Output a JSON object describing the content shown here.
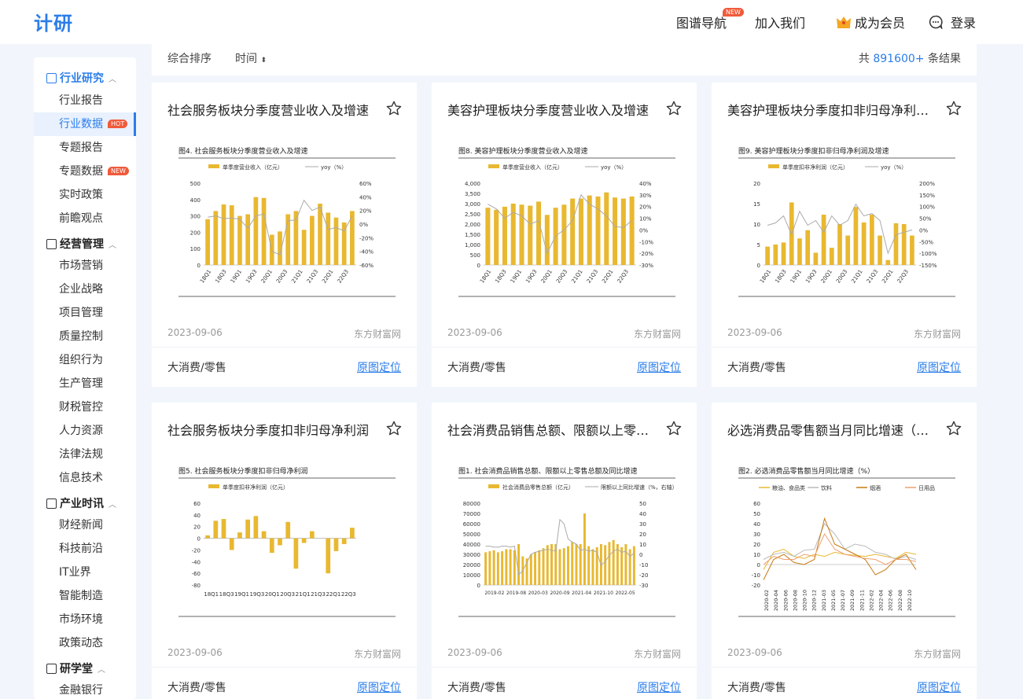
{
  "header": {
    "logo": "计研",
    "nav_guide": "图谱导航",
    "nav_guide_badge": "NEW",
    "nav_join": "加入我们",
    "nav_member": "成为会员",
    "nav_login": "登录"
  },
  "sidebar": {
    "sections": [
      {
        "label": "行业研究",
        "items": [
          "行业报告",
          "行业数据",
          "专题报告",
          "专题数据",
          "实时政策",
          "前瞻观点"
        ]
      },
      {
        "label": "经营管理",
        "items": [
          "市场营销",
          "企业战略",
          "项目管理",
          "质量控制",
          "组织行为",
          "生产管理",
          "财税管控",
          "人力资源",
          "法律法规",
          "信息技术"
        ]
      },
      {
        "label": "产业时讯",
        "items": [
          "财经新闻",
          "科技前沿",
          "IT业界",
          "智能制造",
          "市场环境",
          "政策动态"
        ]
      },
      {
        "label": "研学堂",
        "items": [
          "金融银行"
        ]
      }
    ],
    "tag_hot": "HOT",
    "tag_new": "NEW"
  },
  "sortbar": {
    "sort_default": "综合排序",
    "sort_time": "时间",
    "count_prefix": "共",
    "count_value": "891600+",
    "count_suffix": "条结果"
  },
  "cards": [
    {
      "title": "社会服务板块分季度营业收入及增速",
      "date": "2023-09-06",
      "source": "东方财富网",
      "category": "大消费/零售",
      "link": "原图定位"
    },
    {
      "title": "美容护理板块分季度营业收入及增速",
      "date": "2023-09-06",
      "source": "东方财富网",
      "category": "大消费/零售",
      "link": "原图定位"
    },
    {
      "title": "美容护理板块分季度扣非归母净利润及增速",
      "date": "2023-09-06",
      "source": "东方财富网",
      "category": "大消费/零售",
      "link": "原图定位"
    },
    {
      "title": "社会服务板块分季度扣非归母净利润",
      "date": "2023-09-06",
      "source": "东方财富网",
      "category": "大消费/零售",
      "link": "原图定位"
    },
    {
      "title": "社会消费品销售总额、限额以上零售总额及同比增速",
      "date": "2023-09-06",
      "source": "东方财富网",
      "category": "大消费/零售",
      "link": "原图定位"
    },
    {
      "title": "必选消费品零售额当月同比增速（%）",
      "date": "2023-09-06",
      "source": "东方财富网",
      "category": "大消费/零售",
      "link": "原图定位"
    }
  ],
  "thumbnails": [
    {
      "title": "图4. 社会服务板块分季度营业收入及增速",
      "legend_bar": "单季度营业收入（亿元）",
      "legend_line": "yoy（%）",
      "x": [
        "18Q1",
        "18Q3",
        "19Q1",
        "19Q3",
        "20Q1",
        "20Q3",
        "21Q1",
        "21Q3",
        "22Q1",
        "22Q3"
      ],
      "left_ticks": [
        "500",
        "400",
        "300",
        "200",
        "100",
        "0"
      ],
      "right_ticks": [
        "60%",
        "40%",
        "20%",
        "0%",
        "-20%",
        "-40%",
        "-60%"
      ],
      "left_range": [
        0,
        500
      ],
      "right_range": [
        -60,
        60
      ],
      "bars": [
        280,
        330,
        370,
        365,
        300,
        310,
        415,
        410,
        185,
        205,
        310,
        330,
        215,
        300,
        375,
        320,
        290,
        260,
        330
      ],
      "line": [
        10,
        12,
        8,
        9,
        7,
        -6,
        12,
        15,
        -40,
        -45,
        5,
        6,
        35,
        20,
        25,
        -8,
        -5,
        -10,
        12
      ]
    },
    {
      "title": "图8. 美容护理板块分季度营业收入及增速",
      "legend_bar": "单季度营业收入（亿元）",
      "legend_line": "yoy（%）",
      "x": [
        "18Q1",
        "18Q3",
        "19Q1",
        "19Q3",
        "20Q1",
        "20Q3",
        "21Q1",
        "21Q3",
        "22Q1",
        "22Q3"
      ],
      "left_ticks": [
        "4,000",
        "3,500",
        "3,000",
        "2,500",
        "2,000",
        "1,500",
        "1,000",
        "500",
        "0"
      ],
      "right_ticks": [
        "40%",
        "30%",
        "20%",
        "10%",
        "0%",
        "-10%",
        "-20%",
        "-30%"
      ],
      "left_range": [
        0,
        4000
      ],
      "right_range": [
        -30,
        40
      ],
      "bars": [
        2800,
        2700,
        2850,
        3000,
        2950,
        2900,
        3100,
        2450,
        2800,
        2950,
        3250,
        3250,
        3400,
        3350,
        3550,
        3300,
        3250,
        3350
      ],
      "line": [
        22,
        18,
        10,
        15,
        12,
        5,
        8,
        -20,
        -5,
        0,
        8,
        30,
        22,
        18,
        12,
        3,
        2,
        8
      ]
    },
    {
      "title": "图9. 美容护理板块分季度扣非归母净利润及增速",
      "legend_bar": "单季度扣非净利润（亿元）",
      "legend_line": "yoy（%）",
      "x": [
        "18Q1",
        "18Q3",
        "19Q1",
        "19Q3",
        "20Q1",
        "20Q3",
        "21Q1",
        "21Q3",
        "22Q1",
        "22Q3"
      ],
      "left_ticks": [
        "20",
        "15",
        "10",
        "5",
        "0"
      ],
      "right_ticks": [
        "200%",
        "150%",
        "100%",
        "50%",
        "0%",
        "-50%",
        "-100%",
        "-150%"
      ],
      "left_range": [
        0,
        20
      ],
      "right_range": [
        -150,
        200
      ],
      "bars": [
        4.5,
        5,
        5.5,
        15.3,
        6.5,
        8.5,
        3,
        12.3,
        4.2,
        10,
        7.2,
        14.2,
        10.4,
        12.3,
        7.2,
        1.2,
        10.2,
        10,
        7.2
      ],
      "line": [
        20,
        30,
        60,
        -20,
        80,
        20,
        40,
        -10,
        60,
        20,
        40,
        110,
        60,
        70,
        40,
        -100,
        -20,
        -10,
        0
      ]
    },
    {
      "title": "图5. 社会服务板块分季度扣非归母净利润",
      "legend_bar": "单季度扣非净利润（亿元）",
      "legend_line": "",
      "x": [
        "18Q1",
        "18Q3",
        "19Q1",
        "19Q3",
        "20Q1",
        "20Q3",
        "21Q1",
        "21Q3",
        "22Q1",
        "22Q3"
      ],
      "left_ticks": [
        "60",
        "40",
        "20",
        "0",
        "-20",
        "-40",
        "-60",
        "-80"
      ],
      "right_ticks": [],
      "left_range": [
        -80,
        60
      ],
      "right_range": [
        0,
        1
      ],
      "bars": [
        5,
        30,
        33,
        -20,
        10,
        32,
        38,
        12,
        -25,
        -12,
        28,
        -52,
        -8,
        12,
        0,
        -60,
        -22,
        -10,
        18
      ],
      "line": []
    },
    {
      "title": "图1. 社会消费品销售总额、限额以上零售总额及同比增速",
      "legend_bar": "社会消费品零售总额（亿元）",
      "legend_line": "限额以上同比增速（%，右轴）",
      "x": [
        "2019-02",
        "2019-08",
        "2020-03",
        "2020-09",
        "2021-04",
        "2021-10",
        "2022-05"
      ],
      "left_ticks": [
        "80000",
        "70000",
        "60000",
        "50000",
        "40000",
        "30000",
        "20000",
        "10000",
        "0"
      ],
      "right_ticks": [
        "50",
        "40",
        "30",
        "20",
        "10",
        "0",
        "-10",
        "-20",
        "-30"
      ],
      "left_range": [
        0,
        80000
      ],
      "right_range": [
        -30,
        50
      ],
      "bars": [
        32000,
        33000,
        34000,
        32000,
        33000,
        35000,
        35000,
        34000,
        40000,
        28000,
        26000,
        30000,
        32000,
        34000,
        36000,
        39000,
        40000,
        40000,
        35000,
        36000,
        38000,
        42000,
        40000,
        40000,
        70000,
        38000,
        35000,
        37000,
        40000,
        39000,
        42000,
        44000,
        40000,
        37000,
        40000,
        35000,
        38000
      ],
      "line": [
        8,
        8,
        7,
        7,
        8,
        8,
        7,
        8,
        -20,
        -16,
        -8,
        0,
        2,
        3,
        4,
        5,
        4,
        3,
        34,
        30,
        15,
        12,
        10,
        4,
        5,
        3,
        4,
        2,
        -11,
        -7,
        -1,
        3,
        5,
        2,
        3,
        -2,
        1
      ]
    },
    {
      "title": "图2. 必选消费品零售额当月同比增速（%）",
      "legend_bar": "",
      "legend_line": "粮油、食品类",
      "legend_series": [
        "粮油、食品类",
        "饮料",
        "烟酒",
        "日用品"
      ],
      "x": [
        "2020-02",
        "2020-04",
        "2020-06",
        "2020-08",
        "2020-10",
        "2020-12",
        "2021-03",
        "2021-05",
        "2021-07",
        "2021-09",
        "2021-11",
        "2022-02",
        "2022-04",
        "2022-06",
        "2022-08",
        "2022-10"
      ],
      "left_ticks": [
        "60",
        "50",
        "40",
        "30",
        "20",
        "10",
        "0",
        "-10",
        "-20"
      ],
      "right_ticks": [],
      "left_range": [
        -20,
        60
      ],
      "right_range": [
        0,
        1
      ],
      "bars": [],
      "line": []
    }
  ]
}
